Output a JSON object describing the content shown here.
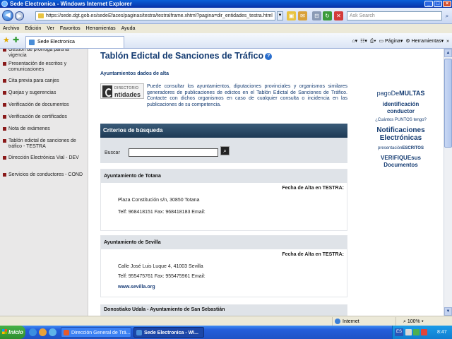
{
  "window": {
    "title": "Sede Electronica - Windows Internet Explorer",
    "minimize": "_",
    "maximize": "□",
    "close": "×"
  },
  "address_bar": {
    "url": "https://sede.dgt.gob.es/sedeEfaces/paginas/testra/testraIframe.xhtml?pagina=dir_entidades_testra.html",
    "search_placeholder": "Ask Search"
  },
  "menu": [
    "Archivo",
    "Edición",
    "Ver",
    "Favoritos",
    "Herramientas",
    "Ayuda"
  ],
  "tab": {
    "label": "Sede Electronica"
  },
  "command_bar": {
    "page_label": "Página",
    "tools_label": "Herramientas"
  },
  "sidebar": {
    "items": [
      "Gestión de prórroga para la vigencia",
      "Presentación de escritos y comunicaciones",
      "Cita previa para canjes",
      "Quejas y sugerencias",
      "Verificación de documentos",
      "Verificación de certificados",
      "Nota de exámenes",
      "Tablón edictal de sanciones de tráfico - TESTRA",
      "Dirección Electrónica Vial - DEV",
      "Servicios de conductores - COND"
    ]
  },
  "main": {
    "title": "Tablón Edictal de Sanciones de Tráfico",
    "section_label": "Ayuntamientos dados de alta",
    "logo_small": "DIRECTORIO",
    "logo_big": "ntidades",
    "intro": "Puede consultar los ayuntamientos, diputaciones provinciales y organismos similares generadores de publicaciones de edictos en el Tablón Edictal de Sanciones de Tráfico. Contacte con dichos organismos en caso de cualquier consulta o incidencia en las publicaciones de su competencia.",
    "criteria_title": "Criterios de búsqueda",
    "search_label": "Buscar",
    "date_label": "Fecha de Alta en TESTRA:",
    "cards": [
      {
        "name": "Ayuntamiento de Totana",
        "address": "Plaza Constitución s/n, 30850 Totana",
        "phones": "Telf: 968418151 Fax: 968418183 Email:",
        "web": ""
      },
      {
        "name": "Ayuntamiento de Sevilla",
        "address": "Calle José Luis Luque 4, 41003 Sevilla",
        "phones": "Telf: 955475761 Fax: 955475961 Email:",
        "web": "www.sevilla.org"
      },
      {
        "name": "Donostiako Udala - Ayuntamiento de San Sebastián",
        "address": "",
        "phones": "",
        "web": ""
      }
    ]
  },
  "right_links": {
    "pago_pre": "pagoDe",
    "pago_post": "MULTAS",
    "identificacion": "identificación conductor",
    "puntos": "¿Cuántos PUNTOS tengo?",
    "notificaciones": "Notificaciones Electrónicas",
    "escritos_pre": "presentación",
    "escritos_post": "ESCRITOS",
    "verifique": "VERIFIQUEsus Documentos"
  },
  "status": {
    "zone": "Internet",
    "zoom": "100%"
  },
  "taskbar": {
    "start": "Inicio",
    "tasks": [
      "Dirección General de Trá...",
      "Sede Electronica - Wi..."
    ],
    "lang": "ES",
    "clock": "8:47"
  },
  "colors": {
    "title_blue": "#163d73",
    "criteria_head": "#2b4a66",
    "sidebar_bg": "#e9e8e8"
  }
}
